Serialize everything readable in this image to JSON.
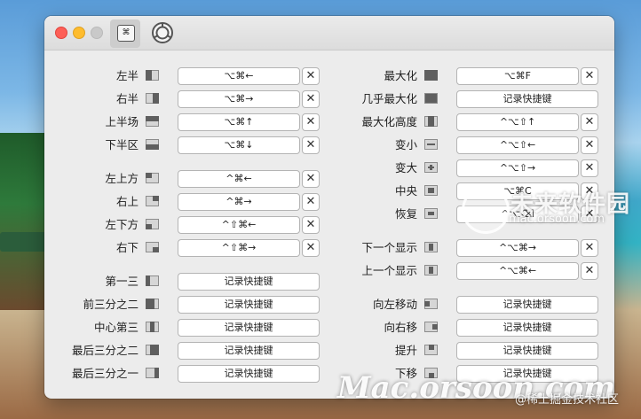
{
  "toolbar": {
    "shortcuts_icon": "command-keycap-icon",
    "settings_icon": "gear-icon"
  },
  "left_rows": [
    {
      "label": "左半",
      "shortcut": "⌥⌘←",
      "icon": "left-half-icon",
      "has_clear": true
    },
    {
      "label": "右半",
      "shortcut": "⌥⌘→",
      "icon": "right-half-icon",
      "has_clear": true
    },
    {
      "label": "上半场",
      "shortcut": "⌥⌘↑",
      "icon": "top-half-icon",
      "has_clear": true
    },
    {
      "label": "下半区",
      "shortcut": "⌥⌘↓",
      "icon": "bottom-half-icon",
      "has_clear": true
    },
    {
      "label": "左上方",
      "shortcut": "^⌘←",
      "icon": "top-left-icon",
      "has_clear": true
    },
    {
      "label": "右上",
      "shortcut": "^⌘→",
      "icon": "top-right-icon",
      "has_clear": true
    },
    {
      "label": "左下方",
      "shortcut": "^⇧⌘←",
      "icon": "bottom-left-icon",
      "has_clear": true
    },
    {
      "label": "右下",
      "shortcut": "^⇧⌘→",
      "icon": "bottom-right-icon",
      "has_clear": true
    },
    {
      "label": "第一三",
      "shortcut": "记录快捷键",
      "icon": "first-third-icon",
      "has_clear": false
    },
    {
      "label": "前三分之二",
      "shortcut": "记录快捷键",
      "icon": "first-two-thirds-icon",
      "has_clear": false
    },
    {
      "label": "中心第三",
      "shortcut": "记录快捷键",
      "icon": "center-third-icon",
      "has_clear": false
    },
    {
      "label": "最后三分之二",
      "shortcut": "记录快捷键",
      "icon": "last-two-thirds-icon",
      "has_clear": false
    },
    {
      "label": "最后三分之一",
      "shortcut": "记录快捷键",
      "icon": "last-third-icon",
      "has_clear": false
    }
  ],
  "right_rows": [
    {
      "label": "最大化",
      "shortcut": "⌥⌘F",
      "icon": "maximize-icon",
      "has_clear": true
    },
    {
      "label": "几乎最大化",
      "shortcut": "记录快捷键",
      "icon": "almost-maximize-icon",
      "has_clear": false
    },
    {
      "label": "最大化高度",
      "shortcut": "^⌥⇧↑",
      "icon": "maximize-height-icon",
      "has_clear": true
    },
    {
      "label": "变小",
      "shortcut": "^⌥⇧←",
      "icon": "smaller-icon",
      "has_clear": true
    },
    {
      "label": "变大",
      "shortcut": "^⌥⇧→",
      "icon": "larger-icon",
      "has_clear": true
    },
    {
      "label": "中央",
      "shortcut": "⌥⌘C",
      "icon": "center-icon",
      "has_clear": true
    },
    {
      "label": "恢复",
      "shortcut": "^⌥⌫",
      "icon": "restore-icon",
      "has_clear": true
    },
    {
      "label": "下一个显示",
      "shortcut": "^⌥⌘→",
      "icon": "next-display-icon",
      "has_clear": true
    },
    {
      "label": "上一个显示",
      "shortcut": "^⌥⌘←",
      "icon": "previous-display-icon",
      "has_clear": true
    },
    {
      "label": "向左移动",
      "shortcut": "记录快捷键",
      "icon": "move-left-icon",
      "has_clear": false
    },
    {
      "label": "向右移",
      "shortcut": "记录快捷键",
      "icon": "move-right-icon",
      "has_clear": false
    },
    {
      "label": "提升",
      "shortcut": "记录快捷键",
      "icon": "move-up-icon",
      "has_clear": false
    },
    {
      "label": "下移",
      "shortcut": "记录快捷键",
      "icon": "move-down-icon",
      "has_clear": false
    }
  ],
  "clear_symbol": "✕",
  "watermark": {
    "brand": "未来软件园",
    "site": "mac.orsoon.com",
    "big": "Mac.orsoon.com",
    "small": "@稀土掘金技术社区"
  }
}
